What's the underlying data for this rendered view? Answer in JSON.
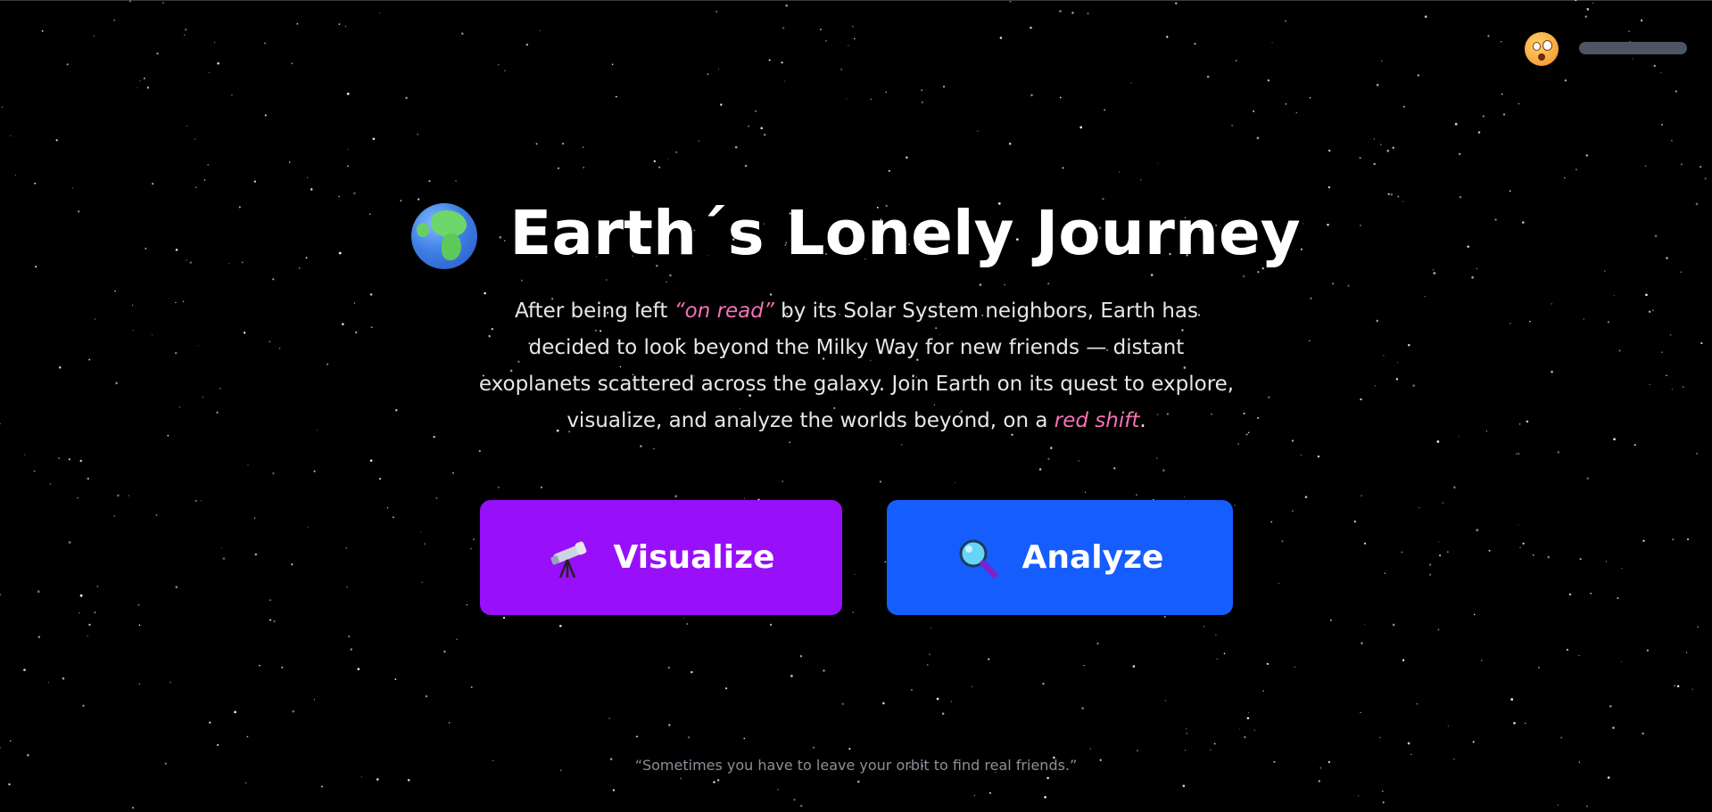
{
  "header": {
    "avatar_icon": "astonished-face-icon",
    "toggle_icon": "slider-toggle"
  },
  "hero": {
    "title_icon": "globe-europe-africa-icon",
    "title": "Earth´s Lonely Journey",
    "description": {
      "part1": "After being left ",
      "accent1": "“on read”",
      "part2": " by its Solar System neighbors, Earth has decided to look beyond the Milky Way for new friends — distant exoplanets scattered across the galaxy. Join Earth on its quest to explore, visualize, and analyze the worlds beyond, on a ",
      "accent2": "red shift",
      "part3": "."
    }
  },
  "actions": {
    "visualize": {
      "label": "Visualize",
      "icon": "telescope-icon",
      "color": "#9810fa"
    },
    "analyze": {
      "label": "Analyze",
      "icon": "magnifying-glass-icon",
      "color": "#155dfc"
    }
  },
  "footer": {
    "quote": "“Sometimes you have to leave your orbit to find real friends.”"
  },
  "colors": {
    "background": "#000000",
    "accent_text": "#f472b6"
  }
}
